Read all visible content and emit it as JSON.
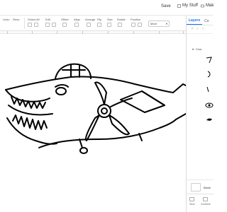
{
  "topbar": {
    "save_label": "Save",
    "mystuff_label": "My Stuff",
    "make_label": "Mak"
  },
  "toolbar": {
    "undo_label": "Undo",
    "redo_label": "Redo",
    "select_all_label": "Select All",
    "edit_label": "Edit",
    "offset_label": "Offset",
    "align_label": "Align",
    "arrange_label": "Arrange",
    "flip_label": "Flip",
    "size_label": "Size",
    "rotate_label": "Rotate",
    "position_label": "Position",
    "more_label": "More"
  },
  "panel": {
    "tab_layers": "Layers",
    "tab_color_sync": "Co",
    "group_label": "Croc",
    "canvas_label": "Blank",
    "tool_labels": [
      "Slice",
      "Combine"
    ]
  },
  "colors": {
    "accent": "#1a73e8",
    "line": "#000000"
  },
  "icons": [
    "save-icon",
    "mystuff-icon",
    "make-icon",
    "chevron-down-icon",
    "eye-icon"
  ]
}
